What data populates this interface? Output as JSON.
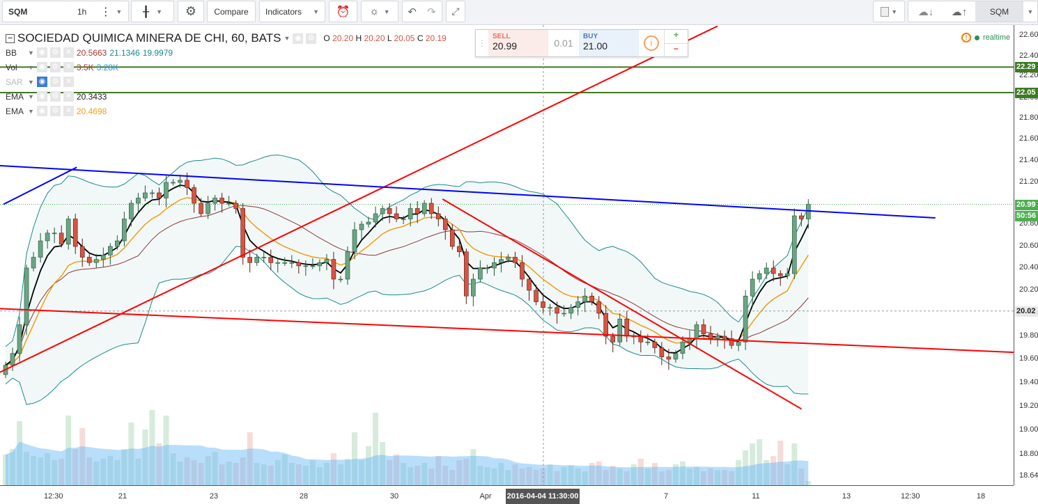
{
  "toolbar": {
    "symbol": "SQM",
    "interval": "1h",
    "compare": "Compare",
    "indicators": "Indicators",
    "right_symbol": "SQM"
  },
  "legend": {
    "title": "SOCIEDAD QUIMICA MINERA DE CHI, 60, BATS",
    "o_label": "O",
    "o": "20.20",
    "h_label": "H",
    "h": "20.20",
    "l_label": "L",
    "l": "20.05",
    "c_label": "C",
    "c": "20.19",
    "bb": {
      "name": "BB",
      "v1": "20.5663",
      "v2": "21.1346",
      "v3": "19.9979"
    },
    "vol": {
      "name": "Vol",
      "v1": "3.5K",
      "v2": "3.28K"
    },
    "sar": {
      "name": "SAR"
    },
    "ema1": {
      "name": "EMA",
      "v": "20.3433"
    },
    "ema2": {
      "name": "EMA",
      "v": "20.4698"
    }
  },
  "trade": {
    "sell_label": "SELL",
    "sell": "20.99",
    "spread": "0.01",
    "buy_label": "BUY",
    "buy": "21.00",
    "plus": "+",
    "minus": "−"
  },
  "status": {
    "realtime": "realtime"
  },
  "colors": {
    "up": "#6ba583",
    "down": "#d75442",
    "hline": "#3d7a22",
    "bb": "#1a8a8a",
    "ema_fast": "#000000",
    "ema_slow": "#f39c12",
    "ema_mid": "#8b3a3a"
  },
  "chart_data": {
    "type": "candlestick",
    "price_ticks": [
      "22.60",
      "22.40",
      "22.20",
      "22.00",
      "21.80",
      "21.60",
      "21.40",
      "21.20",
      "20.80",
      "20.60",
      "20.40",
      "20.20",
      "19.80",
      "19.60",
      "19.40",
      "19.20",
      "19.00",
      "18.80",
      "18.64"
    ],
    "time_ticks": [
      "12:30",
      "21",
      "23",
      "28",
      "30",
      "Apr",
      "7",
      "11",
      "13",
      "12:30",
      "18"
    ],
    "crosshair_time": "2016-04-04 11:30:00",
    "price_labels": {
      "hline1": "22.29",
      "hline2": "22.05",
      "last": "20.99",
      "countdown": "50:56",
      "cross": "20.02"
    },
    "closes": [
      19.55,
      19.65,
      19.9,
      20.4,
      20.5,
      20.65,
      20.72,
      20.72,
      20.62,
      20.85,
      20.6,
      20.5,
      20.45,
      20.48,
      20.52,
      20.6,
      20.65,
      20.85,
      21.0,
      21.05,
      21.1,
      21.1,
      21.05,
      21.2,
      21.2,
      21.22,
      21.15,
      21.0,
      20.9,
      21.0,
      21.05,
      21.0,
      21.0,
      20.95,
      20.5,
      20.45,
      20.5,
      20.5,
      20.45,
      20.45,
      20.45,
      20.45,
      20.42,
      20.42,
      20.42,
      20.45,
      20.48,
      20.3,
      20.3,
      20.55,
      20.75,
      20.8,
      20.82,
      20.9,
      20.95,
      20.9,
      20.85,
      20.85,
      20.95,
      20.9,
      21.0,
      20.9,
      20.85,
      20.75,
      20.6,
      20.55,
      20.15,
      20.3,
      20.4,
      20.4,
      20.45,
      20.48,
      20.5,
      20.45,
      20.3,
      20.2,
      20.1,
      20.05,
      20.05,
      20.0,
      20.0,
      20.05,
      20.1,
      20.15,
      20.1,
      20.0,
      19.8,
      19.75,
      19.95,
      19.8,
      19.8,
      19.75,
      19.75,
      19.7,
      19.62,
      19.6,
      19.65,
      19.75,
      19.78,
      19.9,
      19.82,
      19.78,
      19.8,
      19.78,
      19.72,
      19.75,
      20.15,
      20.3,
      20.35,
      20.4,
      20.35,
      20.33,
      20.35,
      20.88,
      20.85,
      20.99
    ],
    "volumes_k": [
      2.2,
      2.6,
      4.6,
      2.4,
      2.1,
      2.0,
      2.3,
      1.8,
      1.9,
      5.0,
      2.6,
      4.1,
      2.0,
      1.7,
      1.9,
      2.1,
      1.8,
      2.6,
      4.5,
      1.9,
      4.0,
      5.4,
      3.0,
      5.0,
      2.3,
      1.7,
      2.0,
      1.8,
      1.6,
      2.1,
      2.4,
      1.5,
      1.7,
      1.6,
      2.0,
      3.8,
      1.6,
      1.5,
      1.4,
      1.8,
      2.2,
      1.6,
      1.5,
      1.4,
      1.8,
      1.3,
      1.6,
      2.3,
      1.5,
      1.9,
      3.8,
      1.8,
      2.8,
      5.2,
      3.1,
      1.8,
      2.2,
      1.6,
      1.3,
      1.4,
      1.6,
      1.2,
      2.1,
      1.4,
      1.1,
      1.8,
      1.9,
      2.6,
      1.4,
      1.3,
      1.2,
      1.6,
      1.1,
      1.5,
      1.2,
      1.3,
      1.1,
      1.2,
      1.5,
      1.0,
      1.3,
      1.4,
      1.2,
      1.0,
      1.6,
      1.7,
      1.1,
      1.4,
      1.2,
      1.0,
      1.5,
      1.9,
      1.2,
      1.6,
      1.0,
      1.1,
      1.5,
      1.7,
      1.2,
      1.3,
      1.0,
      1.2,
      1.1,
      1.1,
      1.0,
      1.8,
      2.5,
      3.0,
      3.3,
      1.8,
      2.1,
      3.2,
      1.5,
      3.0,
      1.2,
      0.3
    ],
    "drawings": [
      {
        "color": "#ff0000",
        "from": [
          -0.8,
          19.49
        ],
        "to": [
          102,
          22.69
        ]
      },
      {
        "color": "#0000ff",
        "from": [
          -0.8,
          21.355
        ],
        "to": [
          133.2,
          20.86
        ]
      },
      {
        "color": "#0000ff",
        "from": [
          -0.3,
          20.99
        ],
        "to": [
          10.2,
          21.34
        ]
      },
      {
        "color": "#ff0000",
        "from": [
          62.6,
          21.04
        ],
        "to": [
          114,
          19.18
        ]
      },
      {
        "color": "#ff0000",
        "from": [
          -0.8,
          20.04
        ],
        "to": [
          144.4,
          19.66
        ]
      }
    ]
  }
}
